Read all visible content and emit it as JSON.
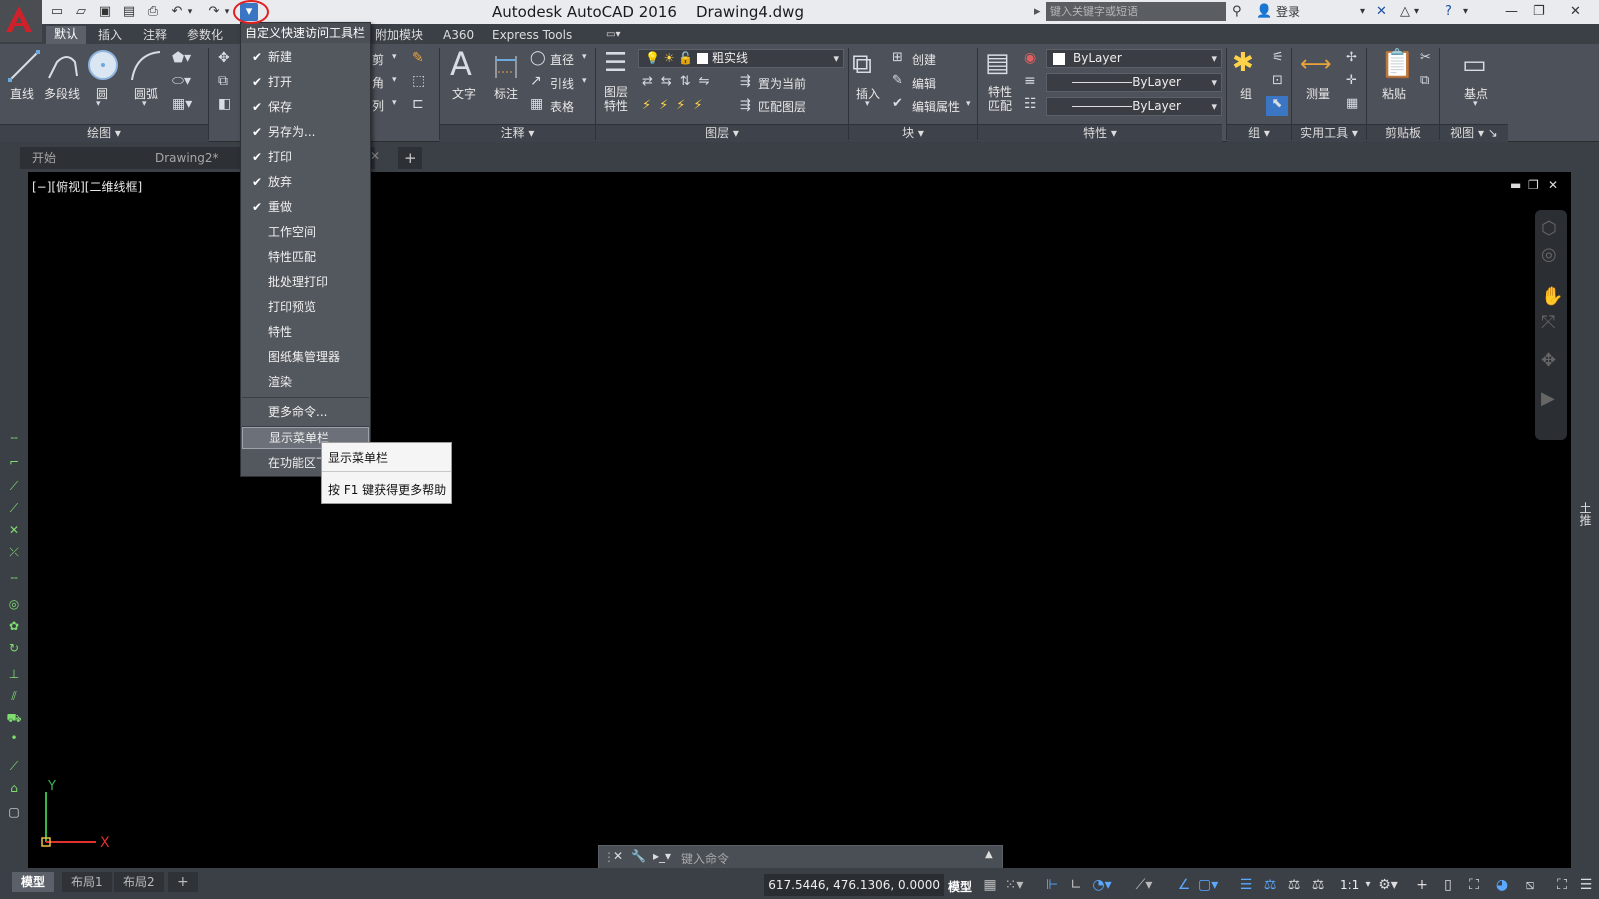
{
  "title_bar": {
    "title": "Autodesk AutoCAD 2016    Drawing4.dwg",
    "search_placeholder": "键入关键字或短语",
    "signin": "登录"
  },
  "ribbon_tabs": [
    "默认",
    "插入",
    "注释",
    "参数化",
    "附加模块",
    "A360",
    "Express Tools"
  ],
  "ribbon": {
    "draw": {
      "line": "直线",
      "polyline": "多段线",
      "circle": "圆",
      "arc": "圆弧",
      "panel": "绘图"
    },
    "annotation": {
      "text": "文字",
      "dimension": "标注",
      "linear": "直径",
      "leader": "引线",
      "table": "表格",
      "panel": "注释"
    },
    "layers": {
      "layer_props": "图层\n特性",
      "layer_name": "粗实线",
      "set_current": "置为当前",
      "match_layer": "匹配图层",
      "panel": "图层"
    },
    "block": {
      "insert": "插入",
      "create": "创建",
      "edit": "编辑",
      "edit_attr": "编辑属性",
      "panel": "块"
    },
    "properties": {
      "match": "特性\n匹配",
      "color": "ByLayer",
      "linetype": "ByLayer",
      "lineweight": "ByLayer",
      "panel": "特性"
    },
    "groups": {
      "group": "组",
      "panel": "组"
    },
    "utilities": {
      "measure": "测量",
      "panel": "实用工具"
    },
    "clipboard": {
      "paste": "粘贴",
      "panel": "剪贴板"
    },
    "view": {
      "base": "基点",
      "panel": "视图"
    },
    "modify_partial": {
      "trim": "剪",
      "fillet": "角",
      "array": "列"
    }
  },
  "file_tabs": [
    "开始",
    "Drawing2*"
  ],
  "viewport_label": "[−][俯视][二维线框]",
  "right_label": "土推",
  "quick_access_menu": {
    "title": "自定义快速访问工具栏",
    "items": [
      {
        "label": "新建",
        "checked": true
      },
      {
        "label": "打开",
        "checked": true
      },
      {
        "label": "保存",
        "checked": true
      },
      {
        "label": "另存为...",
        "checked": true
      },
      {
        "label": "打印",
        "checked": true
      },
      {
        "label": "放弃",
        "checked": true
      },
      {
        "label": "重做",
        "checked": true
      },
      {
        "label": "工作空间",
        "checked": false
      },
      {
        "label": "特性匹配",
        "checked": false
      },
      {
        "label": "批处理打印",
        "checked": false
      },
      {
        "label": "打印预览",
        "checked": false
      },
      {
        "label": "特性",
        "checked": false
      },
      {
        "label": "图纸集管理器",
        "checked": false
      },
      {
        "label": "渲染",
        "checked": false
      }
    ],
    "more": "更多命令...",
    "show_menubar": "显示菜单栏",
    "below_ribbon": "在功能区下"
  },
  "tooltip": {
    "title": "显示菜单栏",
    "help": "按 F1 键获得更多帮助"
  },
  "command_line": {
    "placeholder": "键入命令"
  },
  "layout_tabs": [
    "模型",
    "布局1",
    "布局2"
  ],
  "status": {
    "coords": "617.5446, 476.1306, 0.0000",
    "model": "模型",
    "scale": "1:1"
  },
  "ucs": {
    "x_label": "X",
    "y_label": "Y"
  }
}
